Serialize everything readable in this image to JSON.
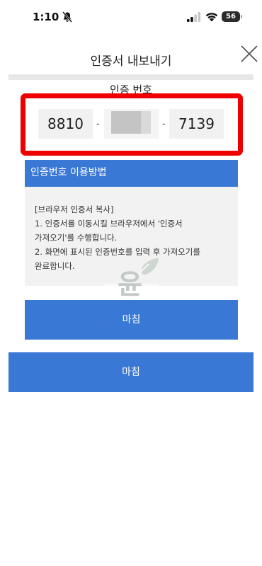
{
  "status_bar": {
    "time": "1:10",
    "battery": "56",
    "icons": [
      "bell-slash-icon",
      "cellular-signal-icon",
      "wifi-icon",
      "battery-icon"
    ]
  },
  "header": {
    "title": "인증서 내보내기",
    "close_icon": "close-icon"
  },
  "auth": {
    "label": "인증 번호",
    "part1": "8810",
    "part3": "7139",
    "separator": "-",
    "highlight_color": "#ee0000"
  },
  "howto": {
    "title": "인증번호 이용방법",
    "lines": [
      "[브라우저 인증서 복사]",
      "1. 인증서를 이동시킬 브라우저에서 '인증서",
      "가져오기'를 수행합니다.",
      "2. 화면에 표시된 인증번호를 입력 후 가져오기를",
      "완료합니다."
    ]
  },
  "watermark_text": "윤",
  "buttons": {
    "done_inner": "마침",
    "done_outer": "마침"
  },
  "colors": {
    "accent": "#3a78d6",
    "panel_bg": "#f2f2f2"
  }
}
